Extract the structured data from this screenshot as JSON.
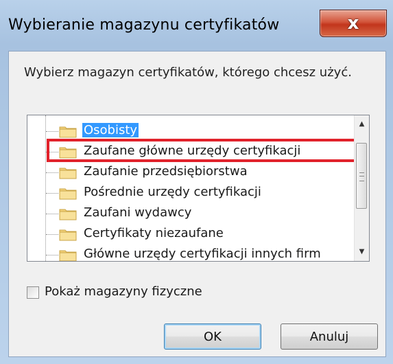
{
  "window": {
    "title": "Wybieranie magazynu certyfikatów",
    "close_glyph": "x"
  },
  "prompt": "Wybierz magazyn certyfikatów, którego chcesz użyć.",
  "tree": {
    "items": [
      {
        "label": "Osobisty",
        "selected": true
      },
      {
        "label": "Zaufane główne urzędy certyfikacji",
        "highlighted": true
      },
      {
        "label": "Zaufanie przedsiębiorstwa"
      },
      {
        "label": "Pośrednie urzędy certyfikacji"
      },
      {
        "label": "Zaufani wydawcy"
      },
      {
        "label": "Certyfikaty niezaufane"
      },
      {
        "label": "Główne urzędy certyfikacji innych firm"
      }
    ],
    "highlight_color": "#e1222b",
    "selection_color": "#3399ff"
  },
  "show_physical": {
    "label": "Pokaż magazyny fizyczne",
    "checked": false
  },
  "buttons": {
    "ok": "OK",
    "cancel": "Anuluj"
  }
}
